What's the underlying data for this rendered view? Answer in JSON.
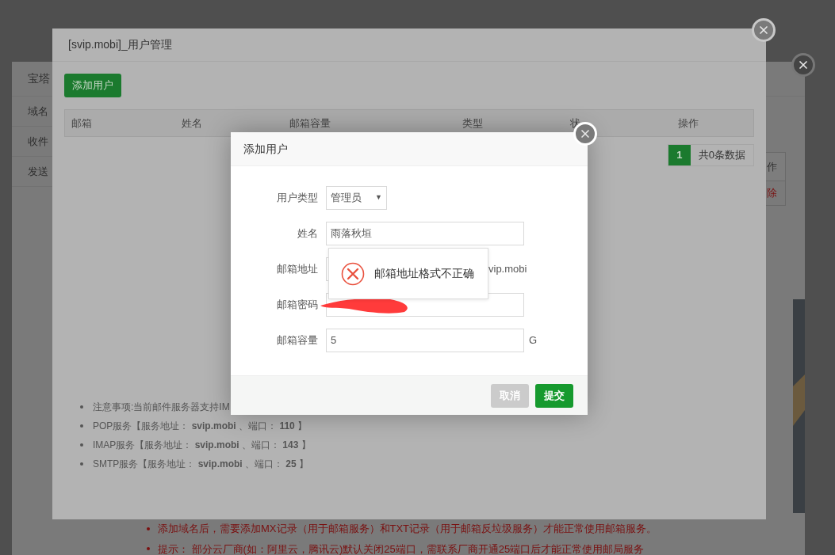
{
  "back_window": {
    "title": "宝塔",
    "sidebar": [
      {
        "label": "域名"
      },
      {
        "label": "收件"
      },
      {
        "label": "发送"
      }
    ],
    "table_header": "作",
    "row_action": "除",
    "notes": [
      "添加域名后，需要添加MX记录（用于邮箱服务）和TXT记录（用于邮箱反垃圾服务）才能正常使用邮箱服务。",
      "提示： 部分云厂商(如：阿里云，腾讯云)默认关闭25端口，需联系厂商开通25端口后才能正常使用邮局服务"
    ]
  },
  "user_window": {
    "title": "[svip.mobi]_用户管理",
    "add_button": "添加用户",
    "columns": [
      "邮箱",
      "姓名",
      "邮箱容量",
      "类型",
      "状",
      "操作"
    ],
    "pagination": {
      "page": "1",
      "total": "共0条数据"
    },
    "notes": [
      "注意事项:当前邮件服务器支持IM",
      "POP服务【服务地址： **svip.mobi** 、端口： **110** 】",
      "IMAP服务【服务地址： **svip.mobi** 、端口： **143** 】",
      "SMTP服务【服务地址： **svip.mobi** 、端口： **25** 】"
    ]
  },
  "dialog": {
    "title": "添加用户",
    "fields": [
      {
        "kind": "select",
        "label": "用户类型",
        "value": "管理员",
        "arrow": "▼"
      },
      {
        "kind": "text",
        "label": "姓名",
        "value": "雨落秋垣"
      },
      {
        "kind": "email",
        "label": "邮箱地址",
        "suffix": "vip.mobi"
      },
      {
        "kind": "password",
        "label": "邮箱密码"
      },
      {
        "kind": "text",
        "label": "邮箱容量",
        "value": "5",
        "suffix": "G"
      }
    ],
    "toast": {
      "message": "邮箱地址格式不正确"
    },
    "buttons": [
      {
        "label": "取消",
        "disabled": true
      },
      {
        "label": "提交",
        "disabled": false
      }
    ]
  }
}
